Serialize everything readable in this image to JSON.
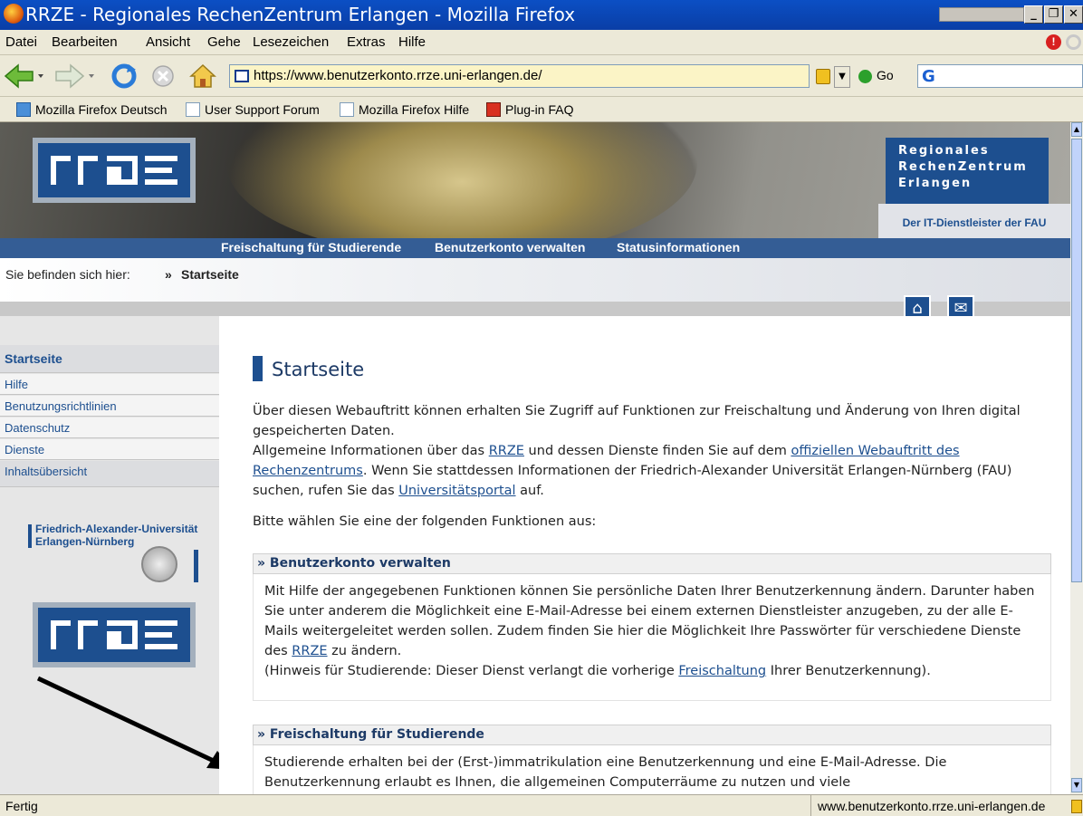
{
  "window": {
    "title": "RRZE - Regionales RechenZentrum Erlangen - Mozilla Firefox"
  },
  "menu": {
    "items": [
      "Datei",
      "Bearbeiten",
      "Ansicht",
      "Gehe",
      "Lesezeichen",
      "Extras",
      "Hilfe"
    ]
  },
  "navbar": {
    "url": "https://www.benutzerkonto.rrze.uni-erlangen.de/",
    "go_label": "Go"
  },
  "bookmarks": [
    "Mozilla Firefox Deutsch",
    "User Support Forum",
    "Mozilla Firefox Hilfe",
    "Plug-in FAQ"
  ],
  "header": {
    "org_line1": "Regionales",
    "org_line2": "RechenZentrum",
    "org_line3": "Erlangen",
    "tagline": "Der IT-Dienstleister der FAU"
  },
  "topnav": [
    "Freischaltung für Studierende",
    "Benutzerkonto verwalten",
    "Statusinformationen"
  ],
  "breadcrumb": {
    "prefix": "Sie befinden sich hier:",
    "current": "Startseite"
  },
  "sidebar": {
    "active": "Startseite",
    "items": [
      "Hilfe",
      "Benutzungsrichtlinien",
      "Datenschutz",
      "Dienste",
      "Inhaltsübersicht"
    ],
    "fau_line1": "Friedrich-Alexander-Universität",
    "fau_line2": "Erlangen-Nürnberg"
  },
  "main": {
    "title": "Startseite",
    "intro1": "Über diesen Webauftritt können erhalten Sie Zugriff auf Funktionen zur Freischaltung und Änderung von Ihren digital gespeicherten Daten.",
    "intro2_a": "Allgemeine Informationen über das ",
    "intro2_link1": "RRZE",
    "intro2_b": " und dessen Dienste finden Sie auf dem ",
    "intro2_link2": "offiziellen Webauftritt des Rechenzentrums",
    "intro2_c": ". Wenn Sie stattdessen Informationen der Friedrich-Alexander Universität Erlangen-Nürnberg (FAU) suchen, rufen Sie das ",
    "intro2_link3": "Universitätsportal",
    "intro2_d": " auf.",
    "choose": "Bitte wählen Sie eine der folgenden Funktionen aus:",
    "section1_title": "Benutzerkonto verwalten",
    "section1_a": "Mit Hilfe der angegebenen Funktionen können Sie persönliche Daten Ihrer Benutzerkennung ändern. Darunter haben Sie unter anderem die Möglichkeit eine E-Mail-Adresse bei einem externen Dienstleister anzugeben, zu der alle E-Mails weitergeleitet werden sollen. Zudem finden Sie hier die Möglichkeit Ihre Passwörter für verschiedene Dienste des ",
    "section1_link1": "RRZE",
    "section1_b": " zu ändern.",
    "section1_c": "(Hinweis für Studierende: Dieser Dienst verlangt die vorherige ",
    "section1_link2": "Freischaltung",
    "section1_d": " Ihrer Benutzerkennung).",
    "section2_title": "Freischaltung für Studierende",
    "section2_text": "Studierende erhalten bei der (Erst-)immatrikulation eine Benutzerkennung und eine E-Mail-Adresse. Die Benutzerkennung erlaubt es Ihnen, die allgemeinen Computerräume zu nutzen und viele"
  },
  "status": {
    "left": "Fertig",
    "right": "www.benutzerkonto.rrze.uni-erlangen.de"
  }
}
